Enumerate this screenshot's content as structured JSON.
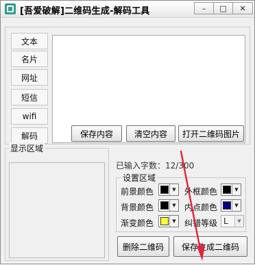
{
  "window": {
    "title": "[吾爱破解]二维码生成-解码工具"
  },
  "titlebar_buttons": {
    "minimize": "–",
    "maximize": "□",
    "close": "✕"
  },
  "tabs": [
    "文本",
    "名片",
    "网址",
    "短信",
    "wifi",
    "解码"
  ],
  "text_input": {
    "value": ""
  },
  "actions": {
    "save_content": "保存内容",
    "clear_content": "清空内容",
    "open_qr_image": "打开二维码图片"
  },
  "display_area": {
    "label": "显示区域"
  },
  "char_count": {
    "text": "已输入字数：12/300"
  },
  "settings": {
    "label": "设置区域",
    "foreground_color": {
      "label": "前景颜色",
      "color": "#000000"
    },
    "border_color": {
      "label": "外框颜色",
      "color": "#000000"
    },
    "background_color": {
      "label": "背景颜色",
      "color": "#000000"
    },
    "inner_point_color": {
      "label": "内点颜色",
      "color": "#000080"
    },
    "gradient_color": {
      "label": "渐变颜色",
      "color": "#ffff33"
    },
    "error_level": {
      "label": "纠错等级",
      "value": "L"
    }
  },
  "bottom_buttons": {
    "delete_qr": "删除二维码",
    "save_generate_qr": "保存生成二维码"
  },
  "annotation": {
    "arrow_color": "#e0253b"
  }
}
